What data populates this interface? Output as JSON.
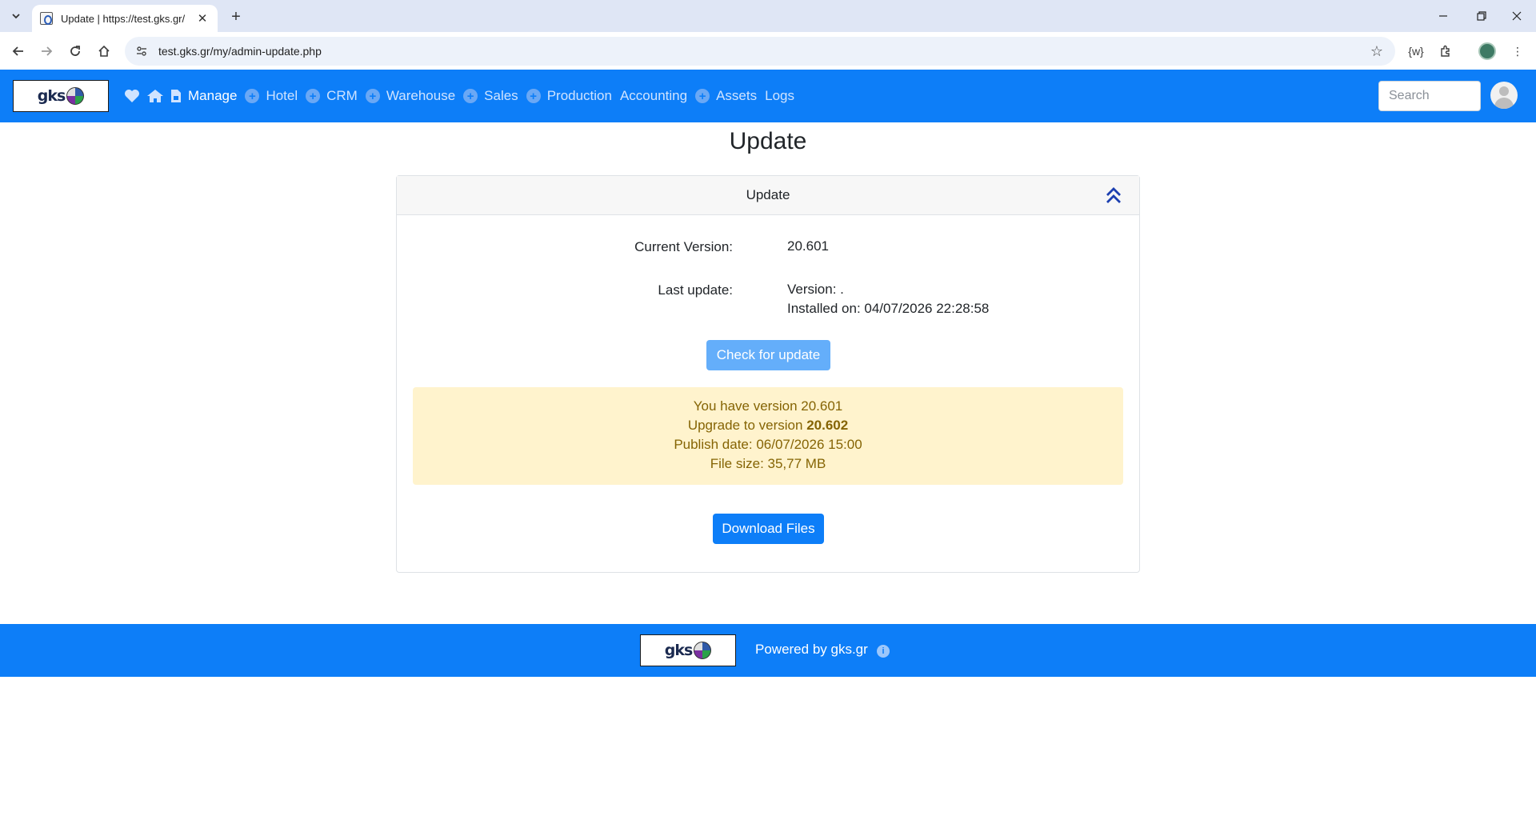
{
  "browser": {
    "tab_title": "Update | https://test.gks.gr/",
    "url": "test.gks.gr/my/admin-update.php"
  },
  "appnav": {
    "items": [
      {
        "label": "Manage"
      },
      {
        "label": "Hotel"
      },
      {
        "label": "CRM"
      },
      {
        "label": "Warehouse"
      },
      {
        "label": "Sales"
      },
      {
        "label": "Production"
      },
      {
        "label": "Accounting"
      },
      {
        "label": "Assets"
      },
      {
        "label": "Logs"
      }
    ],
    "search_placeholder": "Search"
  },
  "page": {
    "title": "Update",
    "card_header": "Update",
    "current_version_label": "Current Version:",
    "current_version_value": "20.601",
    "last_update_label": "Last update:",
    "last_update_version": "Version: .",
    "last_update_installed": "Installed on: 04/07/2026 22:28:58",
    "check_button": "Check for update",
    "alert": {
      "line1": "You have version 20.601",
      "line2_prefix": "Upgrade to version ",
      "line2_version": "20.602",
      "line3": "Publish date: 06/07/2026 15:00",
      "line4": "File size: 35,77 MB"
    },
    "download_button": "Download Files"
  },
  "footer": {
    "powered_by": "Powered by gks.gr"
  },
  "colors": {
    "primary": "#0d7ef8",
    "alert_bg": "#fff3cd",
    "alert_text": "#856404"
  }
}
